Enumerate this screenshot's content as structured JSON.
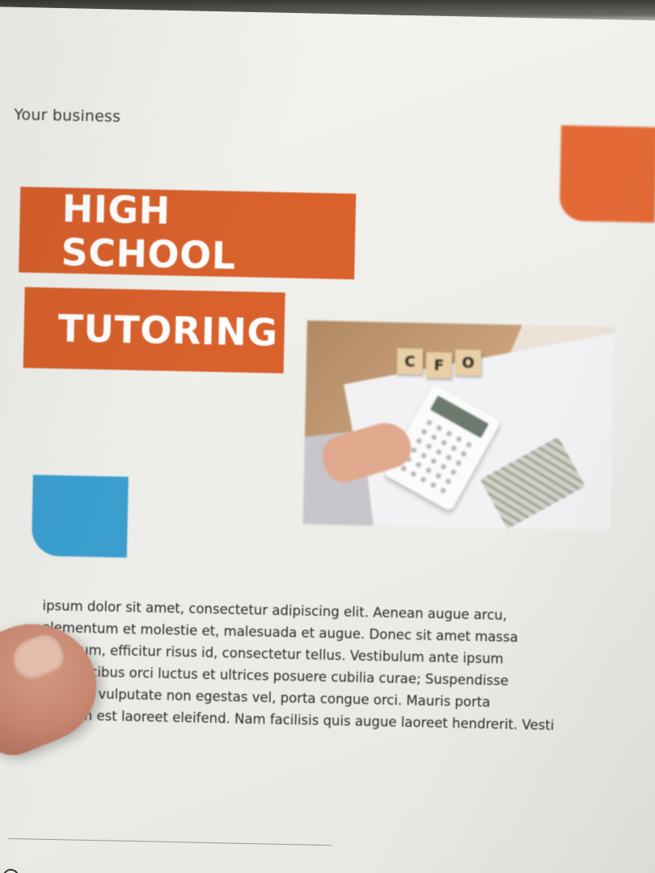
{
  "flyer": {
    "brand": "Your business",
    "title_line_1": "HIGH SCHOOL",
    "title_line_2": "TUTORING",
    "photo_blocks": [
      "C",
      "F",
      "O"
    ],
    "body_lines": [
      "ipsum dolor sit amet, consectetur adipiscing elit. Aenean augue arcu,",
      "elementum et molestie et, malesuada et augue. Donec sit amet massa",
      "imentum, efficitur risus id, consectetur tellus. Vestibulum ante ipsum",
      "s in faucibus orci luctus et ultrices posuere cubilia curae; Suspendisse",
      "ssa nisl, vulputate non egestas vel, porta congue orci. Mauris porta",
      "pretium est laoreet eleifend. Nam facilisis quis augue laoreet hendrerit. Vesti"
    ]
  },
  "colors": {
    "accent_orange": "#d9612c",
    "accent_blue": "#3a9fd0",
    "paper": "#f0f0ec"
  },
  "icons": {
    "photo": "calculator-money-photo",
    "thumb": "thumb-icon"
  }
}
